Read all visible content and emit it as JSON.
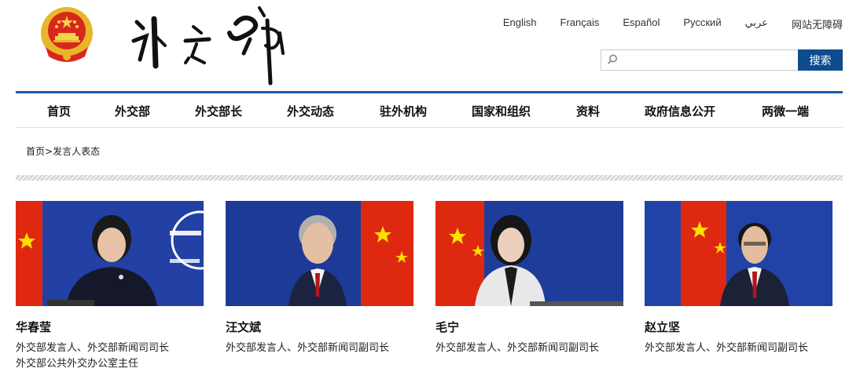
{
  "header": {
    "languages": [
      "English",
      "Français",
      "Español",
      "Русский",
      "عربي",
      "网站无障碍"
    ],
    "search": {
      "placeholder": "",
      "button_label": "搜索"
    }
  },
  "nav": {
    "items": [
      "首页",
      "外交部",
      "外交部长",
      "外交动态",
      "驻外机构",
      "国家和组织",
      "资料",
      "政府信息公开",
      "两微一端"
    ]
  },
  "breadcrumb": {
    "home": "首页",
    "separator": ">",
    "current": "发言人表态"
  },
  "spokespersons": [
    {
      "name": "华春莹",
      "title_line1": "外交部发言人、外交部新闻司司长",
      "title_line2": "外交部公共外交办公室主任"
    },
    {
      "name": "汪文斌",
      "title_line1": "外交部发言人、外交部新闻司副司长",
      "title_line2": ""
    },
    {
      "name": "毛宁",
      "title_line1": "外交部发言人、外交部新闻司副司长",
      "title_line2": ""
    },
    {
      "name": "赵立坚",
      "title_line1": "外交部发言人、外交部新闻司副司长",
      "title_line2": ""
    }
  ],
  "colors": {
    "brand_blue": "#0d4c8f",
    "rule_blue": "#1b5aa6",
    "flag_red": "#de2910",
    "backdrop_blue": "#1e3c9a"
  }
}
